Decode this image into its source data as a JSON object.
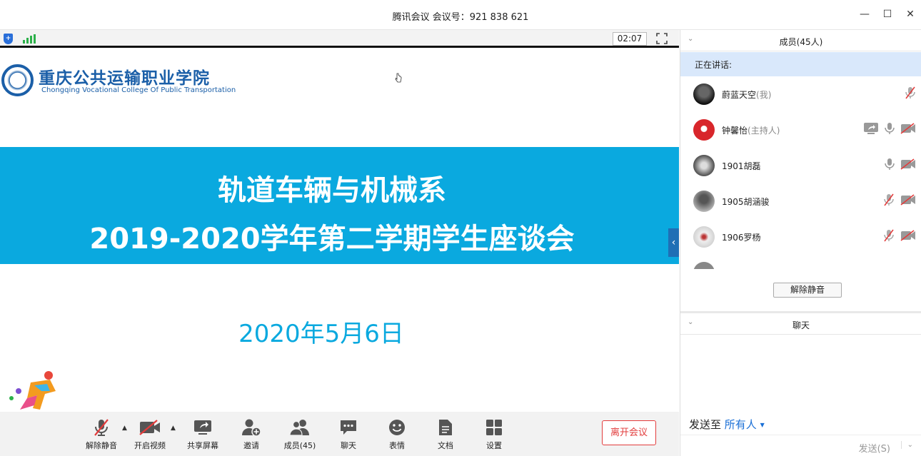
{
  "window": {
    "title": "腾讯会议  会议号：921 838 621",
    "minimize": "—",
    "maximize": "☐",
    "close": "✕"
  },
  "status": {
    "timer": "02:07"
  },
  "slide": {
    "school_name_cn": "重庆公共运输职业学院",
    "school_name_en": "Chongqing Vocational College Of Public Transportation",
    "heading_line1": "轨道车辆与机械系",
    "heading_line2": "2019-2020学年第二学期学生座谈会",
    "date": "2020年5月6日",
    "banner_color": "#0aa9df"
  },
  "toolbar": {
    "unmute": "解除静音",
    "start_video": "开启视频",
    "share_screen": "共享屏幕",
    "invite": "邀请",
    "members": "成员(45)",
    "chat": "聊天",
    "reactions": "表情",
    "docs": "文档",
    "settings": "设置",
    "leave": "离开会议",
    "leave_color": "#e23c3c"
  },
  "members_panel": {
    "title": "成员(45人)",
    "speaking_label": "正在讲话:",
    "items": [
      {
        "name": "蔚蓝天空",
        "role": "(我)"
      },
      {
        "name": "钟馨怡",
        "role": "(主持人)"
      },
      {
        "name": "1901胡磊",
        "role": ""
      },
      {
        "name": "1905胡涵骏",
        "role": ""
      },
      {
        "name": "1906罗杨",
        "role": ""
      }
    ],
    "unmute_all": "解除静音"
  },
  "chat_panel": {
    "title": "聊天",
    "send_to_label": "发送至",
    "send_to_target": "所有人",
    "send_button": "发送(S)"
  }
}
